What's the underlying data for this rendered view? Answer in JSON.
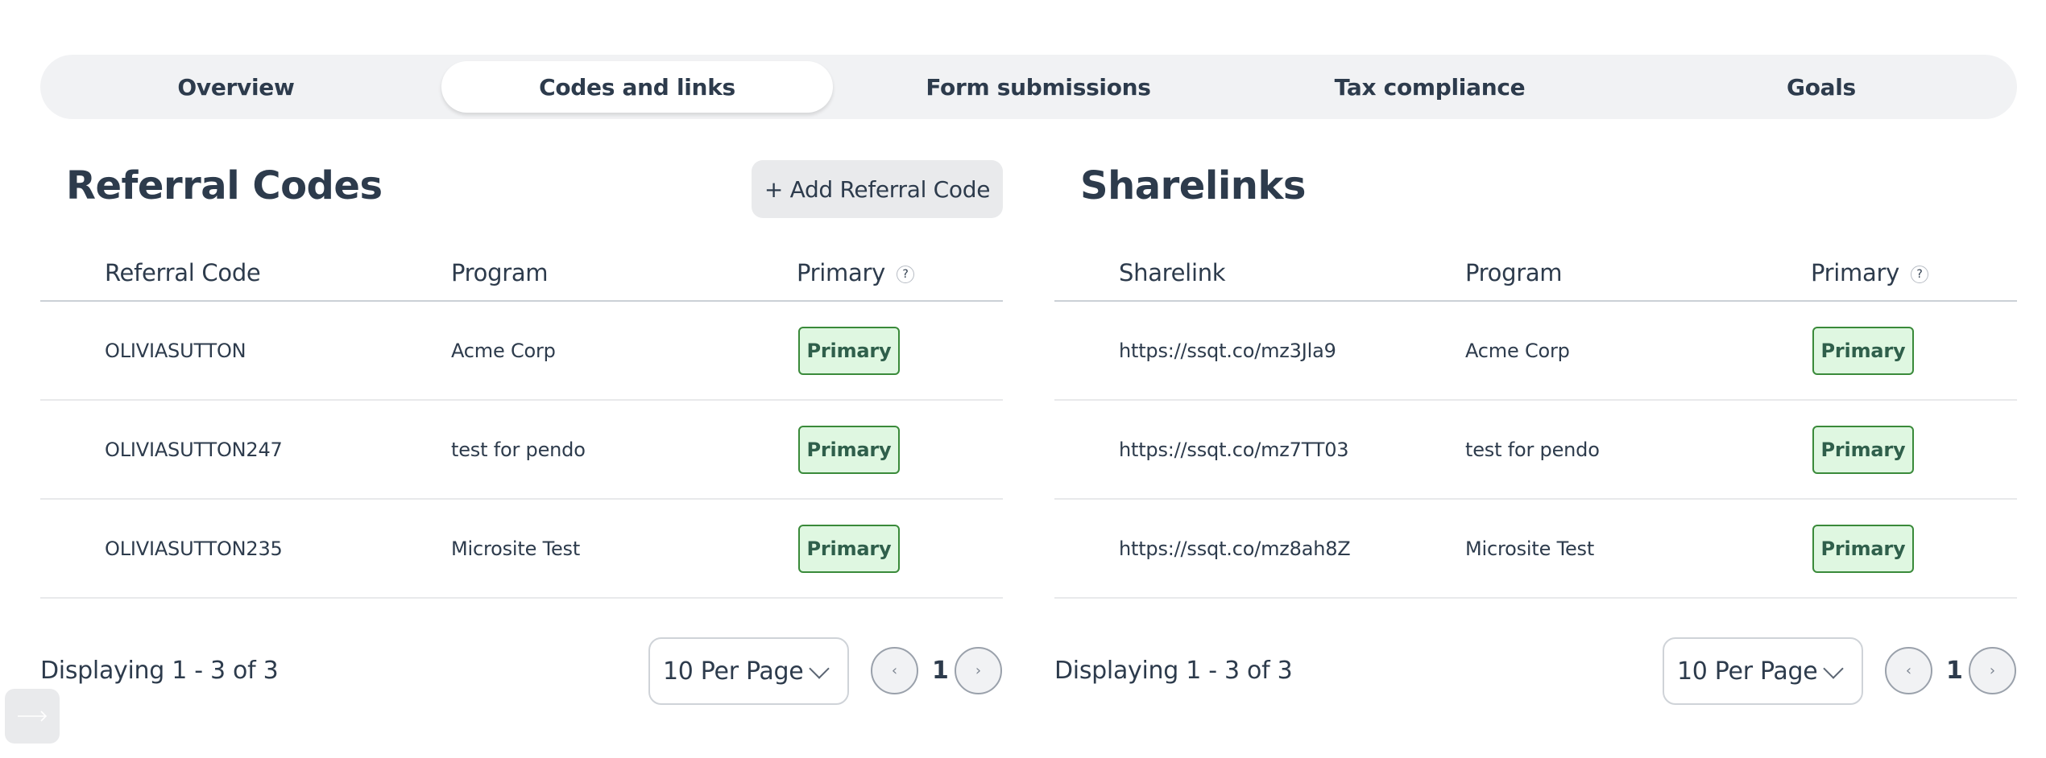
{
  "tabs": [
    {
      "label": "Overview",
      "active": false
    },
    {
      "label": "Codes and links",
      "active": true
    },
    {
      "label": "Form submissions",
      "active": false
    },
    {
      "label": "Tax compliance",
      "active": false
    },
    {
      "label": "Goals",
      "active": false
    }
  ],
  "referral_codes": {
    "title": "Referral Codes",
    "add_button": "+ Add Referral Code",
    "columns": [
      "Referral Code",
      "Program",
      "Primary"
    ],
    "help_icon": "?",
    "rows": [
      {
        "code": "OLIVIASUTTON",
        "program": "Acme Corp",
        "primary": "Primary"
      },
      {
        "code": "OLIVIASUTTON247",
        "program": "test for pendo",
        "primary": "Primary"
      },
      {
        "code": "OLIVIASUTTON235",
        "program": "Microsite Test",
        "primary": "Primary"
      }
    ],
    "footer": {
      "displaying": "Displaying 1 - 3 of 3",
      "per_page": "10 Per Page",
      "page": "1",
      "prev_icon": "‹",
      "next_icon": "›"
    }
  },
  "sharelinks": {
    "title": "Sharelinks",
    "columns": [
      "Sharelink",
      "Program",
      "Primary"
    ],
    "help_icon": "?",
    "rows": [
      {
        "link": "https://ssqt.co/mz3Jla9",
        "program": "Acme Corp",
        "primary": "Primary"
      },
      {
        "link": "https://ssqt.co/mz7TT03",
        "program": "test for pendo",
        "primary": "Primary"
      },
      {
        "link": "https://ssqt.co/mz8ah8Z",
        "program": "Microsite Test",
        "primary": "Primary"
      }
    ],
    "footer": {
      "displaying": "Displaying 1 - 3 of 3",
      "per_page": "10 Per Page",
      "page": "1",
      "prev_icon": "‹",
      "next_icon": "›"
    }
  },
  "colors": {
    "text": "#2d3b4c",
    "tab_bg": "#f1f2f4",
    "badge_bg": "#dff7e1",
    "badge_border": "#3a8a3a",
    "badge_text": "#2f5f4b"
  }
}
